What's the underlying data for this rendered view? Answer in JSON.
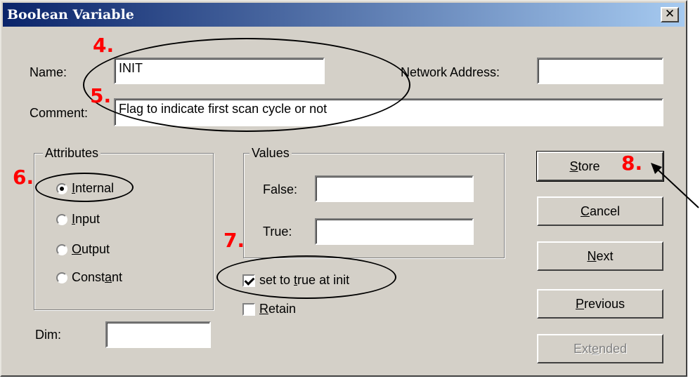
{
  "window": {
    "title": "Boolean Variable",
    "close_glyph": "✕"
  },
  "fields": {
    "name_label": "Name:",
    "name_value": "INIT",
    "network_label": "Network Address:",
    "network_value": "",
    "comment_label": "Comment:",
    "comment_value": "Flag to indicate first scan cycle or not",
    "dim_label": "Dim:",
    "dim_value": ""
  },
  "attributes": {
    "legend": "Attributes",
    "options": [
      {
        "pre": "",
        "key": "I",
        "post": "nternal",
        "selected": true
      },
      {
        "pre": "",
        "key": "I",
        "post": "nput",
        "selected": false
      },
      {
        "pre": "",
        "key": "O",
        "post": "utput",
        "selected": false
      },
      {
        "pre": "Const",
        "key": "a",
        "post": "nt",
        "selected": false
      }
    ]
  },
  "values": {
    "legend": "Values",
    "false_label": "False:",
    "false_value": "",
    "true_label": "True:",
    "true_value": ""
  },
  "checks": {
    "set_true": {
      "pre": "set to ",
      "key": "t",
      "post": "rue at init",
      "checked": true
    },
    "retain": {
      "pre": "",
      "key": "R",
      "post": "etain",
      "checked": false
    }
  },
  "buttons": {
    "store": {
      "pre": "",
      "key": "S",
      "post": "tore"
    },
    "cancel": {
      "pre": "",
      "key": "C",
      "post": "ancel"
    },
    "next": {
      "pre": "",
      "key": "N",
      "post": "ext"
    },
    "previous": {
      "pre": "",
      "key": "P",
      "post": "revious"
    },
    "extended": {
      "pre": "Ext",
      "key": "e",
      "post": "nded",
      "disabled": true
    }
  },
  "annotations": [
    "4.",
    "5.",
    "6.",
    "7.",
    "8."
  ],
  "colors": {
    "annotation": "#ff0000",
    "title_bar_start": "#0a246a",
    "title_bar_end": "#a6caf0",
    "dialog_bg": "#d4d0c8"
  }
}
